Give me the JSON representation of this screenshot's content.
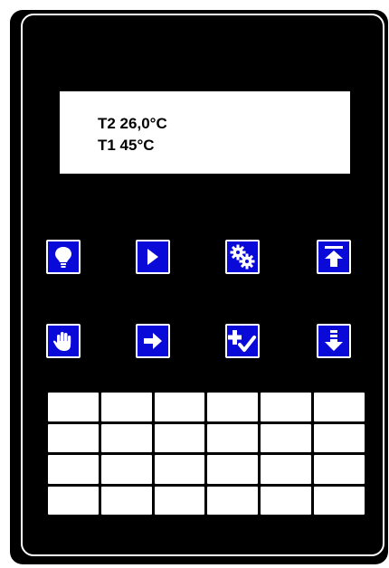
{
  "display": {
    "line1": "T2 26,0°C",
    "line2": "T1 45°C"
  },
  "keys": [
    {
      "icon": "bulb-icon"
    },
    {
      "icon": "play-icon"
    },
    {
      "icon": "gears-icon"
    },
    {
      "icon": "arrow-up-to-top-icon"
    },
    {
      "icon": "hand-icon"
    },
    {
      "icon": "arrow-right-icon"
    },
    {
      "icon": "plus-check-icon"
    },
    {
      "icon": "arrow-down-icon"
    }
  ],
  "colors": {
    "panel": "#000000",
    "key_blue": "#0a0ad8",
    "key_border": "#ffffff",
    "lcd_background": "#ffffff"
  },
  "touch_grid": {
    "rows": 4,
    "columns": 6
  }
}
